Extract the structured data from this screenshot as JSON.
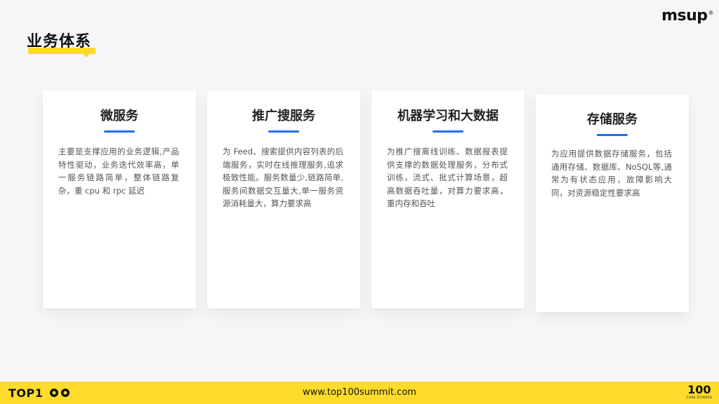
{
  "header": {
    "title": "业务体系",
    "logo_text": "msup",
    "logo_mark": "®"
  },
  "cards": [
    {
      "title": "微服务",
      "body": "主要是支撑应用的业务逻辑,产品特性驱动，业务迭代效率高，单一服务链路简单，整体链路复杂，重 cpu 和 rpc 延迟"
    },
    {
      "title": "推广搜服务",
      "body": "为 Feed、搜索提供内容列表的后端服务，实时在线推理服务,追求极致性能。服务数量少,链路简单,服务间数据交互量大,单一服务资源消耗量大，算力要求高"
    },
    {
      "title": "机器学习和大数据",
      "body": "为推广搜离线训练、数据报表提供支撑的数据处理服务，分布式训练，流式、批式计算场景，超高数据吞吐量，对算力要求高，重内存和吞吐"
    },
    {
      "title": "存储服务",
      "body": "为应用提供数据存储服务，包括通用存储、数据库、NoSQL等,通常为有状态应用，故障影响大同，对资源稳定性要求高"
    }
  ],
  "footer": {
    "left_logo": "TOP1",
    "url": "www.top100summit.com",
    "right_number": "100",
    "right_caption": "CASE STUDIES"
  },
  "colors": {
    "accent_yellow": "#ffdc2b",
    "accent_blue": "#1f6ff2",
    "background": "#f6f6f8"
  }
}
